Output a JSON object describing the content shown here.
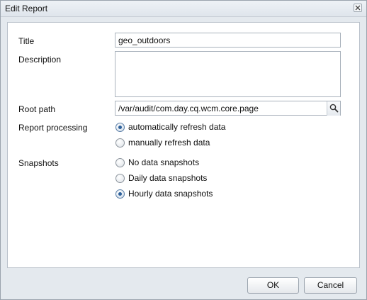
{
  "dialog": {
    "title": "Edit Report",
    "close_icon": "close-icon"
  },
  "form": {
    "title_label": "Title",
    "title_value": "geo_outdoors",
    "description_label": "Description",
    "description_value": "",
    "root_path_label": "Root path",
    "root_path_value": "/var/audit/com.day.cq.wcm.core.page",
    "search_icon": "search-icon",
    "processing_label": "Report processing",
    "processing_options": [
      {
        "label": "automatically refresh data",
        "checked": true
      },
      {
        "label": "manually refresh data",
        "checked": false
      }
    ],
    "snapshots_label": "Snapshots",
    "snapshot_options": [
      {
        "label": "No data snapshots",
        "checked": false
      },
      {
        "label": "Daily data snapshots",
        "checked": false
      },
      {
        "label": "Hourly data snapshots",
        "checked": true
      }
    ]
  },
  "buttons": {
    "ok": "OK",
    "cancel": "Cancel"
  }
}
